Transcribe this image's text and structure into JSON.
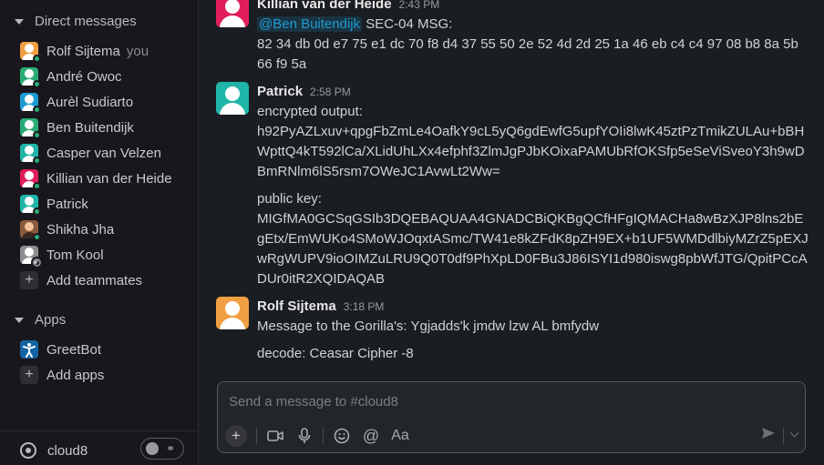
{
  "sidebar": {
    "dm_header": "Direct messages",
    "you_tag": "you",
    "dms": [
      {
        "name": "Rolf Sijtema",
        "color": "#f0a043",
        "you": true,
        "presence": "online"
      },
      {
        "name": "André Owoc",
        "color": "#2bac76",
        "you": false,
        "presence": "online"
      },
      {
        "name": "Aurèl Sudiarto",
        "color": "#1d9bd1",
        "you": false,
        "presence": "online"
      },
      {
        "name": "Ben Buitendijk",
        "color": "#2bac76",
        "you": false,
        "presence": "online"
      },
      {
        "name": "Casper van Velzen",
        "color": "#1fb5a8",
        "you": false,
        "presence": "online"
      },
      {
        "name": "Killian van der Heide",
        "color": "#e01e5a",
        "you": false,
        "presence": "online"
      },
      {
        "name": "Patrick",
        "color": "#1fb5a8",
        "you": false,
        "presence": "online"
      },
      {
        "name": "Shikha Jha",
        "color": "#8a5a3c",
        "you": false,
        "presence": "online"
      },
      {
        "name": "Tom Kool",
        "color": "#8d8e90",
        "you": false,
        "presence": "away"
      }
    ],
    "add_teammates": "Add teammates",
    "apps_header": "Apps",
    "apps": [
      {
        "name": "GreetBot",
        "color": "#1264a3"
      }
    ],
    "add_apps": "Add apps",
    "workspace_name": "cloud8"
  },
  "messages": [
    {
      "author": "Killian van der Heide",
      "time": "2:43 PM",
      "avatar_color": "#e01e5a",
      "mention": "@Ben Buitendijk",
      "lines": [
        "SEC-04 MSG:",
        "82 34 db 0d e7 75 e1 dc 70 f8 d4 37 55 50 2e 52 4d 2d 25 1a 46 eb c4 c4 97 08 b8 8a 5b 66 f9 5a"
      ]
    },
    {
      "author": "Patrick",
      "time": "2:58 PM",
      "avatar_color": "#1fb5a8",
      "lines": [
        "encrypted output:",
        "h92PyAZLxuv+qpgFbZmLe4OafkY9cL5yQ6gdEwfG5upfYOIi8lwK45ztPzTmikZULAu+bBHWpttQ4kT592lCa/XLidUhLXx4efphf3ZlmJgPJbKOixaPAMUbRfOKSfp5eSeViSveoY3h9wDBmRNlm6lS5rsm7OWeJC1AvwLt2Ww=",
        "public key:",
        "MIGfMA0GCSqGSIb3DQEBAQUAA4GNADCBiQKBgQCfHFgIQMACHa8wBzXJP8lns2bEgEtx/EmWUKo4SMoWJOqxtASmc/TW41e8kZFdK8pZH9EX+b1UF5WMDdlbiyMZrZ5pEXJwRgWUPV9ioOIMZuLRU9Q0T0df9PhXpLD0FBu3J86ISYI1d980iswg8pbWfJTG/QpitPCcADUr0itR2XQIDAQAB"
      ]
    },
    {
      "author": "Rolf Sijtema",
      "time": "3:18 PM",
      "avatar_color": "#f0a043",
      "lines": [
        "Message to the Gorilla's: Ygjadds'k jmdw lzw AL bmfydw",
        "decode: Ceasar Cipher -8"
      ]
    }
  ],
  "composer": {
    "placeholder": "Send a message to #cloud8",
    "format_label": "Aa"
  }
}
